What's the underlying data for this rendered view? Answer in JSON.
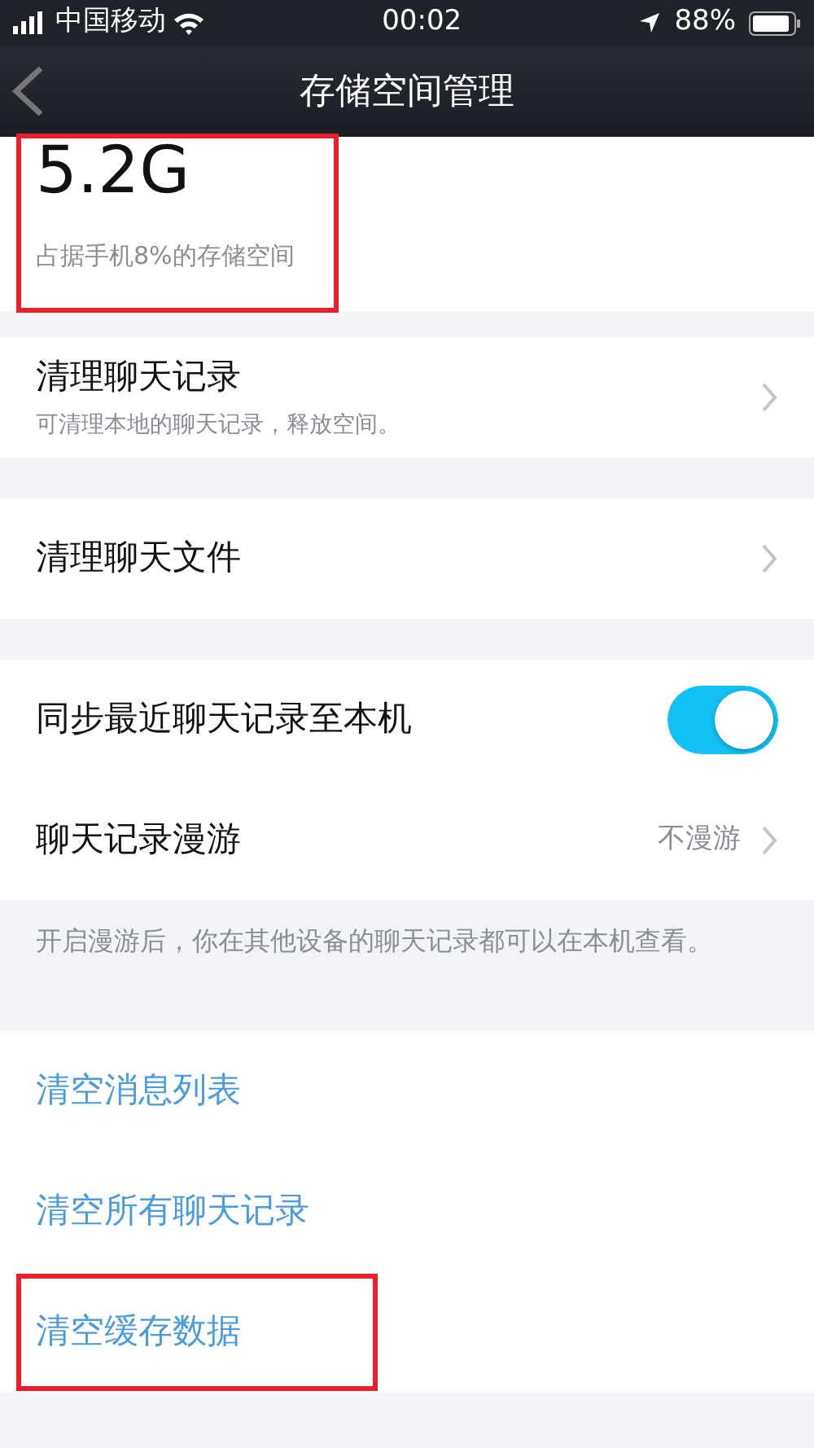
{
  "status_bar": {
    "carrier": "中国移动",
    "time": "00:02",
    "battery": "88%"
  },
  "nav": {
    "title": "存储空间管理"
  },
  "storage": {
    "size": "5.2G",
    "caption": "占据手机8%的存储空间",
    "highlighted": true
  },
  "groups": [
    {
      "items": [
        {
          "kind": "link",
          "title": "清理聊天记录",
          "subtitle": "可清理本地的聊天记录，释放空间。"
        }
      ]
    },
    {
      "items": [
        {
          "kind": "link",
          "title": "清理聊天文件"
        }
      ]
    },
    {
      "items": [
        {
          "kind": "toggle",
          "title": "同步最近聊天记录至本机",
          "on": true
        },
        {
          "kind": "link",
          "title": "聊天记录漫游",
          "value": "不漫游"
        }
      ],
      "footer": "开启漫游后，你在其他设备的聊天记录都可以在本机查看。"
    },
    {
      "items": [
        {
          "kind": "action",
          "title": "清空消息列表",
          "highlighted": false
        },
        {
          "kind": "action",
          "title": "清空所有聊天记录",
          "highlighted": false
        },
        {
          "kind": "action",
          "title": "清空缓存数据",
          "highlighted": true
        }
      ]
    }
  ]
}
